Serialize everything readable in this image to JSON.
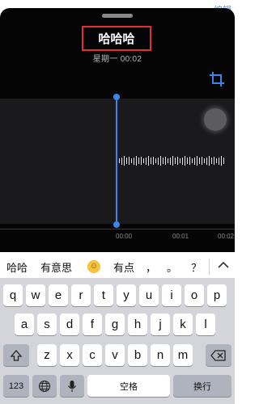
{
  "header": {
    "edit_label": "编辑"
  },
  "recording": {
    "title": "哈哈哈",
    "subtitle": "星期一   00:02"
  },
  "timeline": {
    "tick_labels": [
      "00:00",
      "00:01",
      "00:02"
    ]
  },
  "suggestions": {
    "items": [
      "哈哈",
      "有意思",
      "有点",
      "，",
      "。",
      "？"
    ],
    "emoji": "☺"
  },
  "keyboard": {
    "row1": [
      "q",
      "w",
      "e",
      "r",
      "t",
      "y",
      "u",
      "i",
      "o",
      "p"
    ],
    "row2": [
      "a",
      "s",
      "d",
      "f",
      "g",
      "h",
      "j",
      "k",
      "l"
    ],
    "row3": [
      "z",
      "x",
      "c",
      "v",
      "b",
      "n",
      "m"
    ],
    "numbers_label": "123",
    "space_label": "空格",
    "return_label": "换行"
  },
  "colors": {
    "accent_blue": "#3a86e8",
    "highlight_red": "#e03030",
    "sheet_bg": "#050505",
    "keyboard_bg": "#d3d5da"
  }
}
